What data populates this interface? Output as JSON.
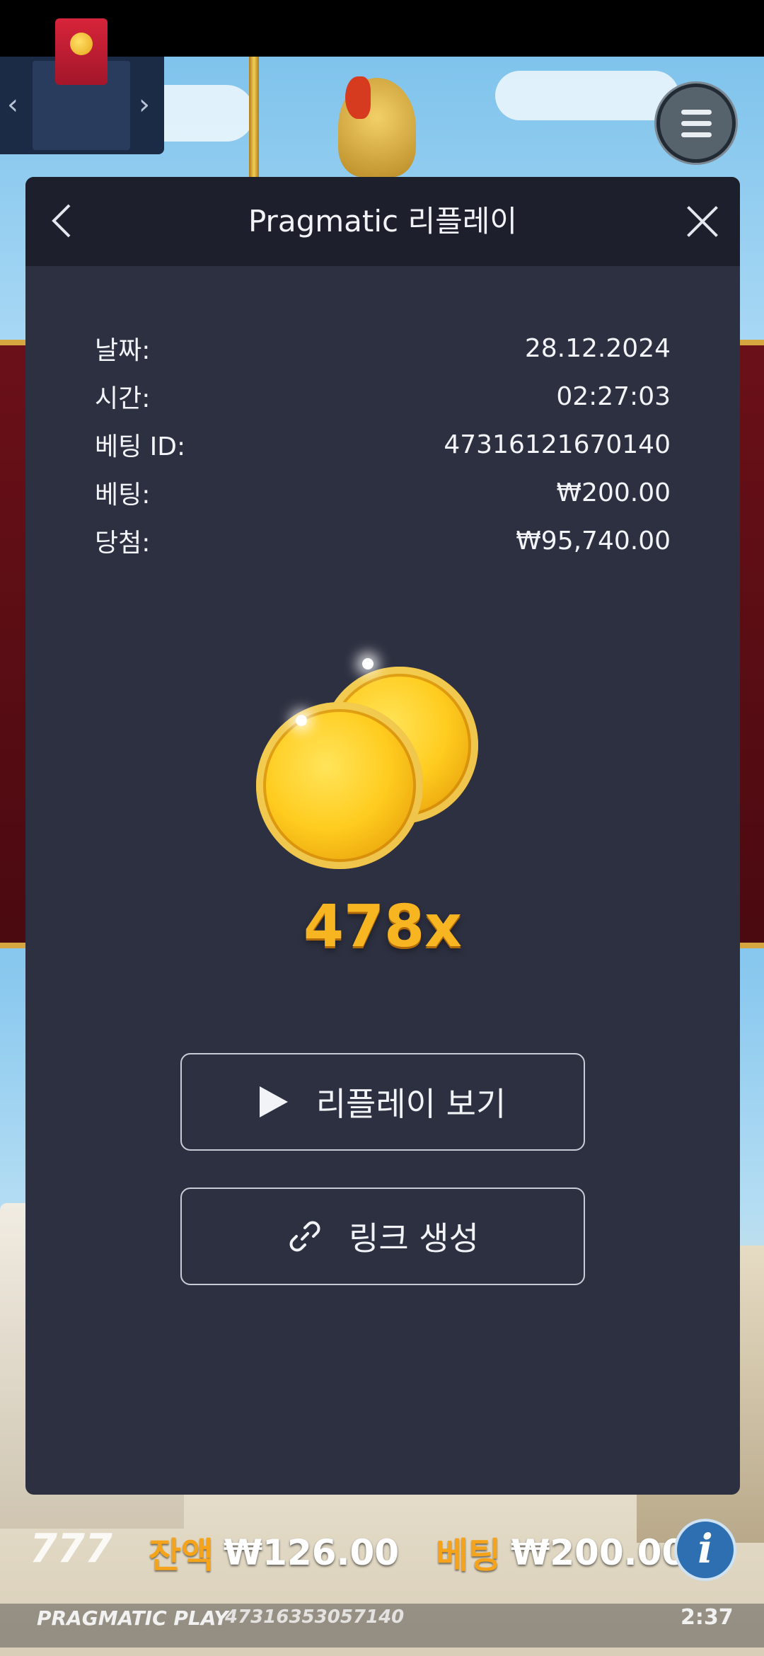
{
  "colors": {
    "modal_bg": "#2d3040",
    "modal_header_bg": "#1d1f2c",
    "accent_orange": "#f5a31a",
    "multiplier_gold": "#f7b522"
  },
  "promo_widget": {
    "prev_icon": "chevron-left-icon",
    "next_icon": "chevron-right-icon",
    "card_icon": "red-envelope-icon"
  },
  "menu_button": {
    "icon": "hamburger-menu-icon"
  },
  "modal": {
    "title": "Pragmatic 리플레이",
    "back_icon": "chevron-left-icon",
    "close_icon": "close-icon",
    "details": [
      {
        "label": "날짜:",
        "value": "28.12.2024"
      },
      {
        "label": "시간:",
        "value": "02:27:03"
      },
      {
        "label": "베팅 ID:",
        "value": "47316121670140"
      },
      {
        "label": "베팅:",
        "value": "₩200.00"
      },
      {
        "label": "당첨:",
        "value": "₩95,740.00"
      }
    ],
    "coins_icon": "gold-coins-icon",
    "multiplier": "478x",
    "replay_button": {
      "label": "리플레이 보기",
      "icon": "play-icon"
    },
    "link_button": {
      "label": "링크 생성",
      "icon": "link-icon"
    }
  },
  "bottom_bar": {
    "balance_label": "잔액",
    "balance_value": "₩126.00",
    "bet_label": "베팅",
    "bet_value": "₩200.00",
    "brand": "PRAGMATIC PLAY",
    "round_id": "47316353057140",
    "clock": "2:37",
    "info_icon": "info-icon",
    "logo_text": "777"
  }
}
